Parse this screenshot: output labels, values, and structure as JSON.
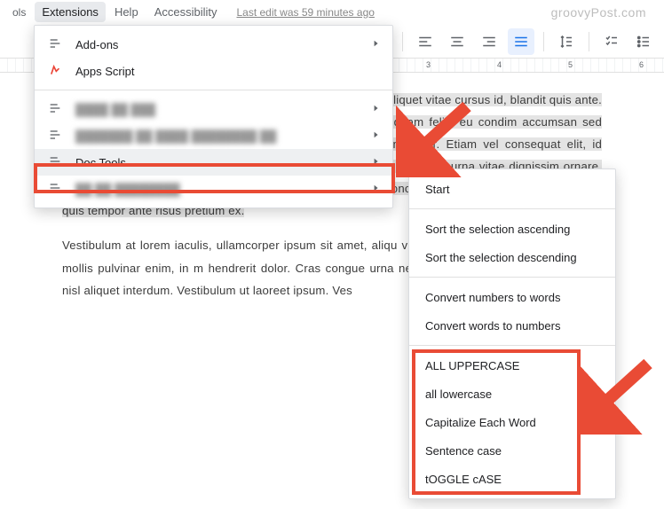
{
  "watermark": "groovyPost.com",
  "menubar": {
    "items": [
      "ols",
      "Extensions",
      "Help",
      "Accessibility"
    ],
    "lastedit": "Last edit was 59 minutes ago"
  },
  "ruler": {
    "ticks": [
      "3",
      "4",
      "5",
      "6"
    ]
  },
  "dropdown": {
    "addons": "Add-ons",
    "appsscript": "Apps Script",
    "blurred1": "████ ██ ███",
    "blurred2": "███████ ██ ████  ████████ ██",
    "doctools": "Doc Tools",
    "blurred3": "██ ██ ████████"
  },
  "submenu": {
    "start": "Start",
    "sort_asc": "Sort the selection ascending",
    "sort_desc": "Sort the selection descending",
    "num2word": "Convert numbers to words",
    "word2num": "Convert words to numbers",
    "upper": "ALL UPPERCASE",
    "lower": "all lowercase",
    "capword": "Capitalize Each Word",
    "sentence": "Sentence case",
    "toggle": "tOGGLE cASE"
  },
  "doc": {
    "selected": "porta non lectus. Maecenas a enim nec odio aliquet porttitor aliquet vitae cursus id, blandit quis ante. Quisque a molestie s vel venenatis. Pellentesque iaculis aliquam felis, eu condim accumsan sed mattis massa efficitur, ut scelerisque leo blan tellus a ullamcorper. Etiam vel consequat elit, id porttitor o dictumst. Phasellus finibus lorem et enim rhoncus, at viverra urna vitae dignissim ornare, est nibh fringilla tellus, ut viverra l vitae eget condimentum rhoncus. Sed cursus, dui eu ultrici lorem, quis tempor ante risus pretium ex.",
    "para2": "Vestibulum at lorem iaculis, ullamcorper ipsum sit amet, aliqu vitae ultrices leo semper in. Quisque mollis pulvinar enim, in m hendrerit dolor. Cras congue urna nec molestie viverra vulputat nibh eu nisl aliquet interdum. Vestibulum ut laoreet ipsum. Ves"
  }
}
